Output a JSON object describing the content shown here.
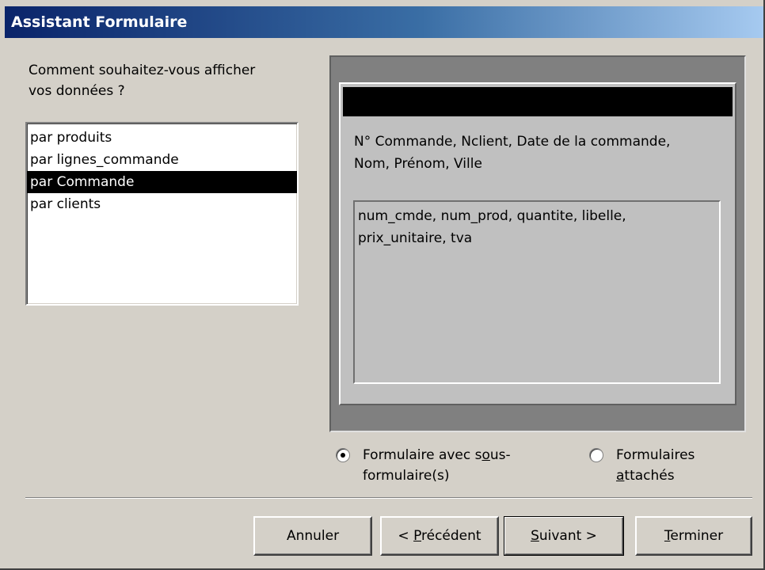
{
  "window": {
    "title": "Assistant Formulaire"
  },
  "prompt": {
    "line1": "Comment souhaitez-vous afficher",
    "line2": "vos données ?"
  },
  "list": {
    "items": [
      {
        "label": "par produits",
        "selected": false
      },
      {
        "label": "par lignes_commande",
        "selected": false
      },
      {
        "label": "par Commande",
        "selected": true
      },
      {
        "label": "par clients",
        "selected": false
      }
    ]
  },
  "preview": {
    "main_fields_line1": "N° Commande, Nclient, Date de la commande,",
    "main_fields_line2": "Nom, Prénom, Ville",
    "subform_line1": "num_cmde, num_prod, quantite, libelle,",
    "subform_line2": "prix_unitaire, tva"
  },
  "options": {
    "subform": {
      "line1_a": "Formulaire avec s",
      "line1_u": "o",
      "line1_b": "us-",
      "line2": "formulaire(s)",
      "checked": true
    },
    "linked": {
      "line1": "Formulaires",
      "line2_u": "a",
      "line2_b": "ttachés",
      "checked": false
    }
  },
  "buttons": {
    "cancel": "Annuler",
    "previous_a": "< ",
    "previous_u": "P",
    "previous_b": "récédent",
    "next_u": "S",
    "next_b": "uivant >",
    "finish_u": "T",
    "finish_b": "erminer"
  }
}
